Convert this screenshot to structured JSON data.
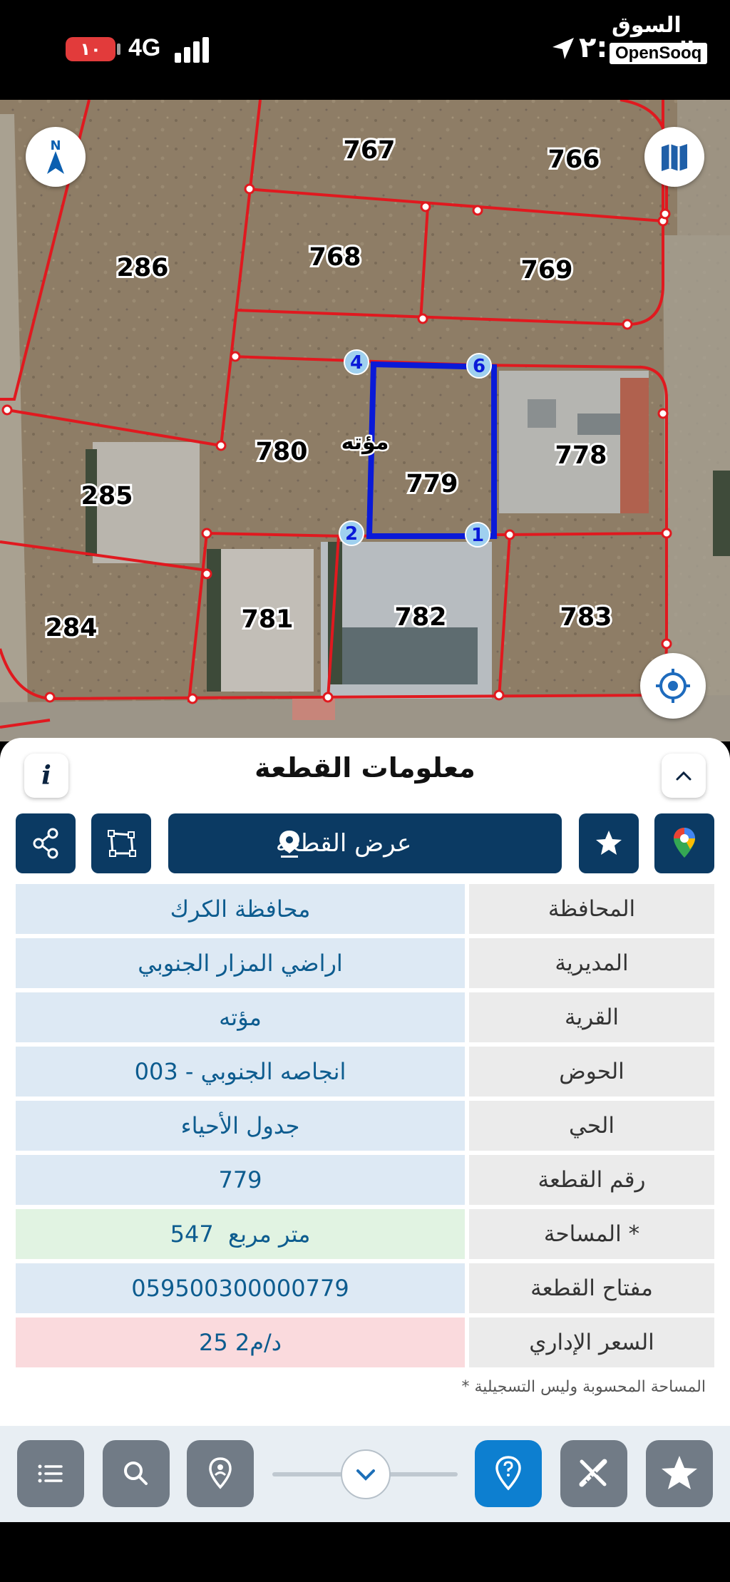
{
  "status_bar": {
    "battery": "١٠",
    "network": "4G",
    "time": "٢:",
    "brand_arabic": "السوق المفتوح",
    "brand_english": "OpenSooq"
  },
  "map": {
    "compass_letter": "N",
    "village_label": "مؤته",
    "plots": [
      "767",
      "766",
      "286",
      "768",
      "769",
      "780",
      "779",
      "778",
      "285",
      "781",
      "782",
      "783",
      "284"
    ],
    "vertices": [
      "4",
      "6",
      "2",
      "1"
    ],
    "selected_plot_color": "#0a1ad8",
    "boundary_color": "#e0191f"
  },
  "panel": {
    "info_icon": "i",
    "title": "معلومات القطعة",
    "view_plot_label": "عرض القطعة",
    "rows": [
      {
        "label": "المحافظة",
        "value": "محافظة الكرك"
      },
      {
        "label": "المديرية",
        "value": "اراضي المزار الجنوبي"
      },
      {
        "label": "القرية",
        "value": "مؤته"
      },
      {
        "label": "الحوض",
        "value": "انجاصه الجنوبي - 003"
      },
      {
        "label": "الحي",
        "value": "جدول الأحياء"
      },
      {
        "label": "رقم القطعة",
        "value": "779"
      },
      {
        "label": "المساحة *",
        "value": "547  متر مربع"
      },
      {
        "label": "مفتاح القطعة",
        "value": "059500300000779"
      },
      {
        "label": "السعر الإداري",
        "value": "25 د/م2"
      }
    ],
    "row_colors": [
      "#dde9f4",
      "#dde9f4",
      "#dde9f4",
      "#dde9f4",
      "#dde9f4",
      "#dde9f4",
      "#e1f3e2",
      "#dde9f4",
      "#fadadd"
    ],
    "footnote": "* المساحة المحسوبة وليس التسجيلية"
  },
  "icons": {
    "action_buttons": [
      "share-icon",
      "polygon-icon",
      "map-pin-icon",
      "star-icon",
      "google-maps-icon"
    ],
    "bottom_toolbar": [
      "list-icon",
      "search-icon",
      "location-person-icon",
      "chevron-down-icon",
      "help-pin-icon",
      "measure-tools-icon",
      "star-icon"
    ]
  }
}
